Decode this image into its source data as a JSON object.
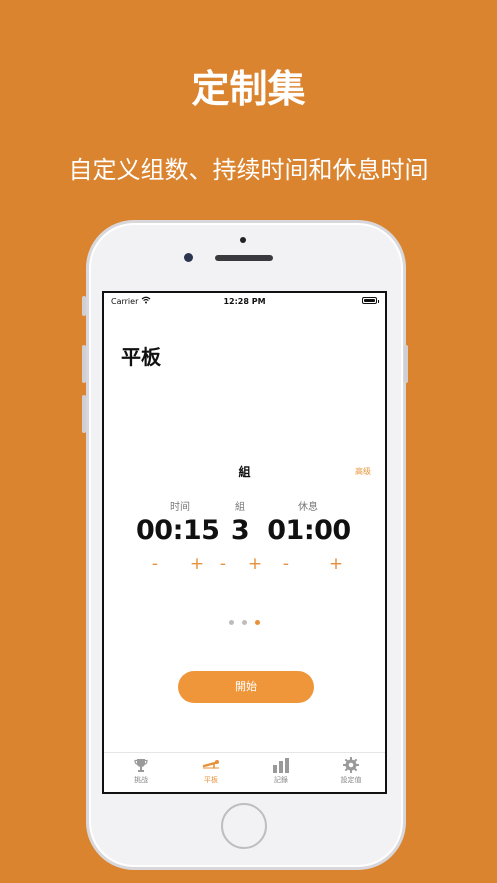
{
  "promo": {
    "title": "定制集",
    "subtitle": "自定义组数、持续时间和休息时间"
  },
  "status_bar": {
    "carrier": "Carrier",
    "time": "12:28 PM"
  },
  "screen": {
    "title": "平板",
    "section_title": "組",
    "advanced_label": "高级",
    "columns": [
      {
        "label": "时间",
        "value": "00:15"
      },
      {
        "label": "組",
        "value": "3"
      },
      {
        "label": "休息",
        "value": "01:00"
      }
    ],
    "minus": "-",
    "plus": "+",
    "page_index": 3,
    "page_count": 3,
    "start_label": "開始"
  },
  "tabs": [
    {
      "label": "挑战",
      "icon": "trophy-icon",
      "active": false
    },
    {
      "label": "平板",
      "icon": "plank-icon",
      "active": true
    },
    {
      "label": "記錄",
      "icon": "bar-chart-icon",
      "active": false
    },
    {
      "label": "設定值",
      "icon": "gear-icon",
      "active": false
    }
  ],
  "colors": {
    "background": "#DB8430",
    "accent": "#E8913A"
  }
}
